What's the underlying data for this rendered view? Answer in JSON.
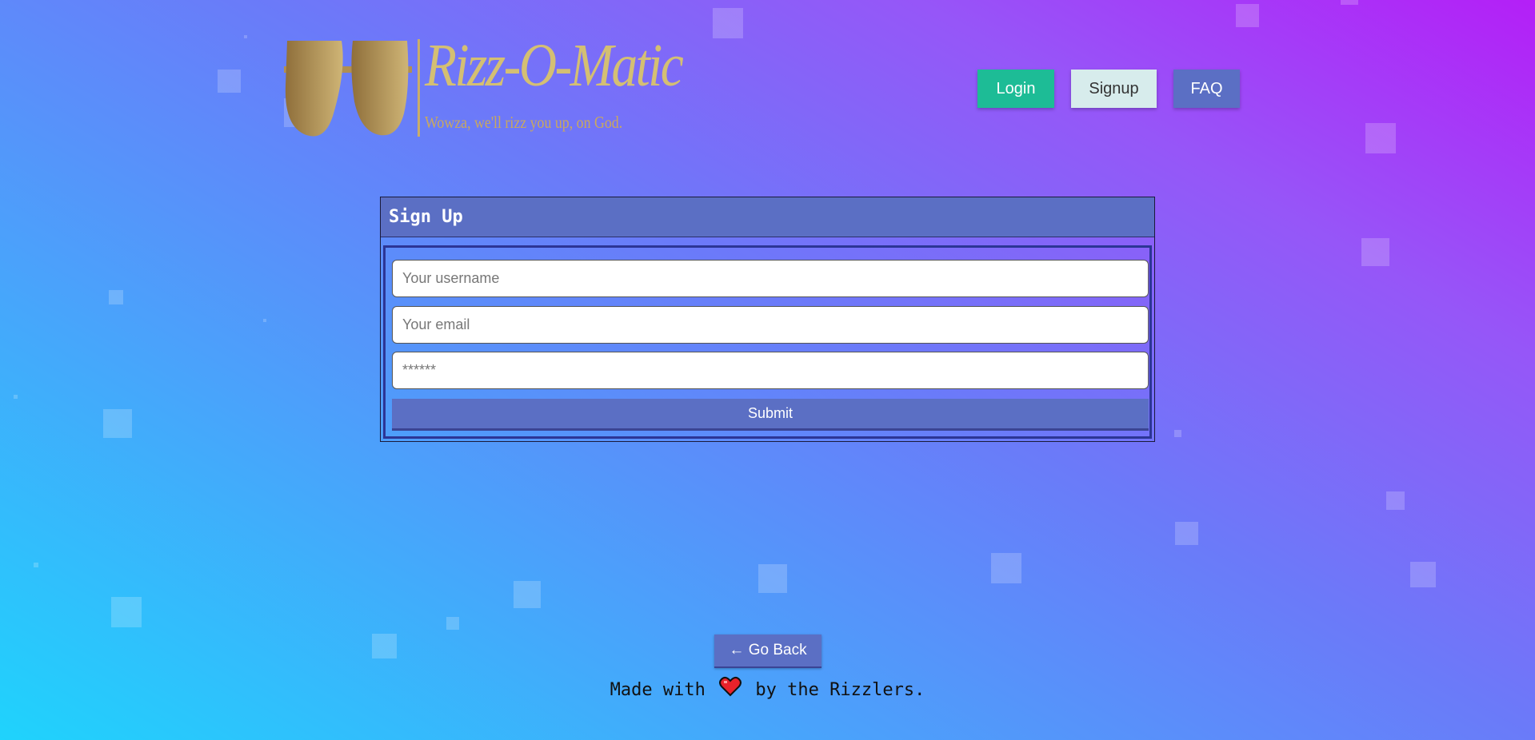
{
  "logo": {
    "title": "Rizz-O-Matic",
    "tagline": "Wowza, we'll rizz you up, on God.",
    "icon": "sunglasses-icon"
  },
  "nav": {
    "login": "Login",
    "signup": "Signup",
    "faq": "FAQ"
  },
  "signup_form": {
    "heading": "Sign Up",
    "username_placeholder": "Your username",
    "email_placeholder": "Your email",
    "password_placeholder": "******",
    "submit": "Submit"
  },
  "footer": {
    "back_button": "← Go Back",
    "made_with": "Made with",
    "heart_icon": "heart-icon",
    "by": "by the Rizzlers."
  },
  "colors": {
    "accent": "#5b6fc4",
    "login": "#1dbc96",
    "signup": "#d7ecec",
    "logo_gold": "#d4bf73",
    "gradient_start": "#1fd3fc",
    "gradient_end": "#b41ff7"
  }
}
